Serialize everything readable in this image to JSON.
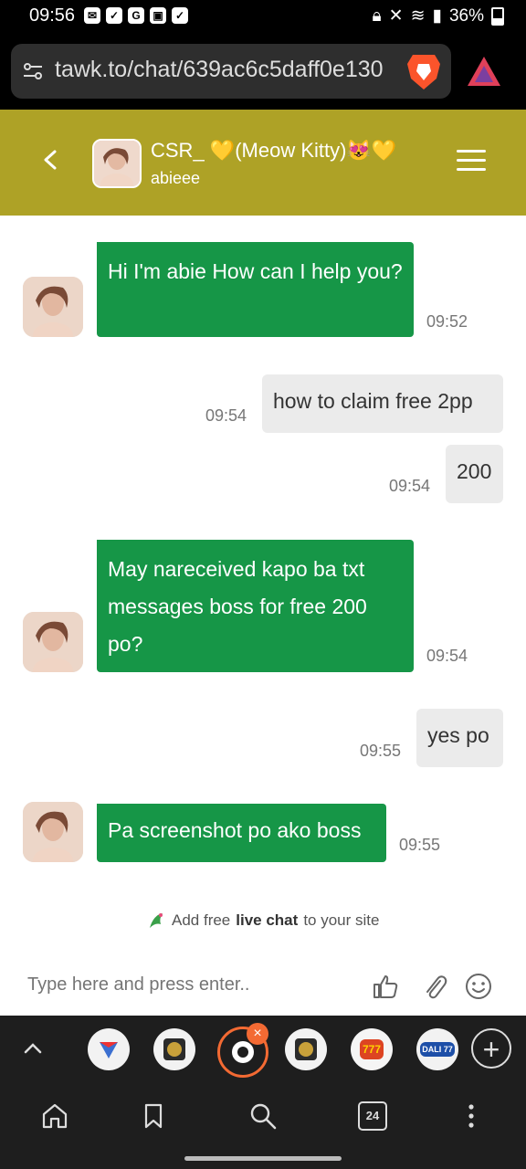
{
  "status_bar": {
    "time": "09:56",
    "battery": "36%"
  },
  "browser": {
    "url": "tawk.to/chat/639ac6c5daff0e130"
  },
  "chat_header": {
    "name": "CSR_ 💛(Meow Kitty)😻💛",
    "subtitle": "abieee"
  },
  "messages": [
    {
      "from": "agent",
      "text": "Hi I'm abie How can I help you?",
      "time": "09:52"
    },
    {
      "from": "visitor",
      "text": "how to claim free 2pp",
      "time": "09:54"
    },
    {
      "from": "visitor",
      "text": "200",
      "time": "09:54"
    },
    {
      "from": "agent",
      "text": "May nareceived kapo ba txt messages boss for free 200 po?",
      "time": "09:54"
    },
    {
      "from": "visitor",
      "text": "yes po",
      "time": "09:55"
    },
    {
      "from": "agent",
      "text": "Pa screenshot po ako boss",
      "time": "09:55"
    }
  ],
  "footer": {
    "pre": "Add free",
    "bold": "live chat",
    "post": "to your site"
  },
  "input": {
    "placeholder": "Type here and press enter.."
  },
  "tabs": {
    "tab1_label": "",
    "tab5_label": "777",
    "tab6_label": "DALI 77",
    "count": "24"
  },
  "colors": {
    "header_bg": "#aea226",
    "agent_bubble": "#169647",
    "visitor_bubble": "#ebebeb",
    "tab_accent": "#f36a33"
  }
}
